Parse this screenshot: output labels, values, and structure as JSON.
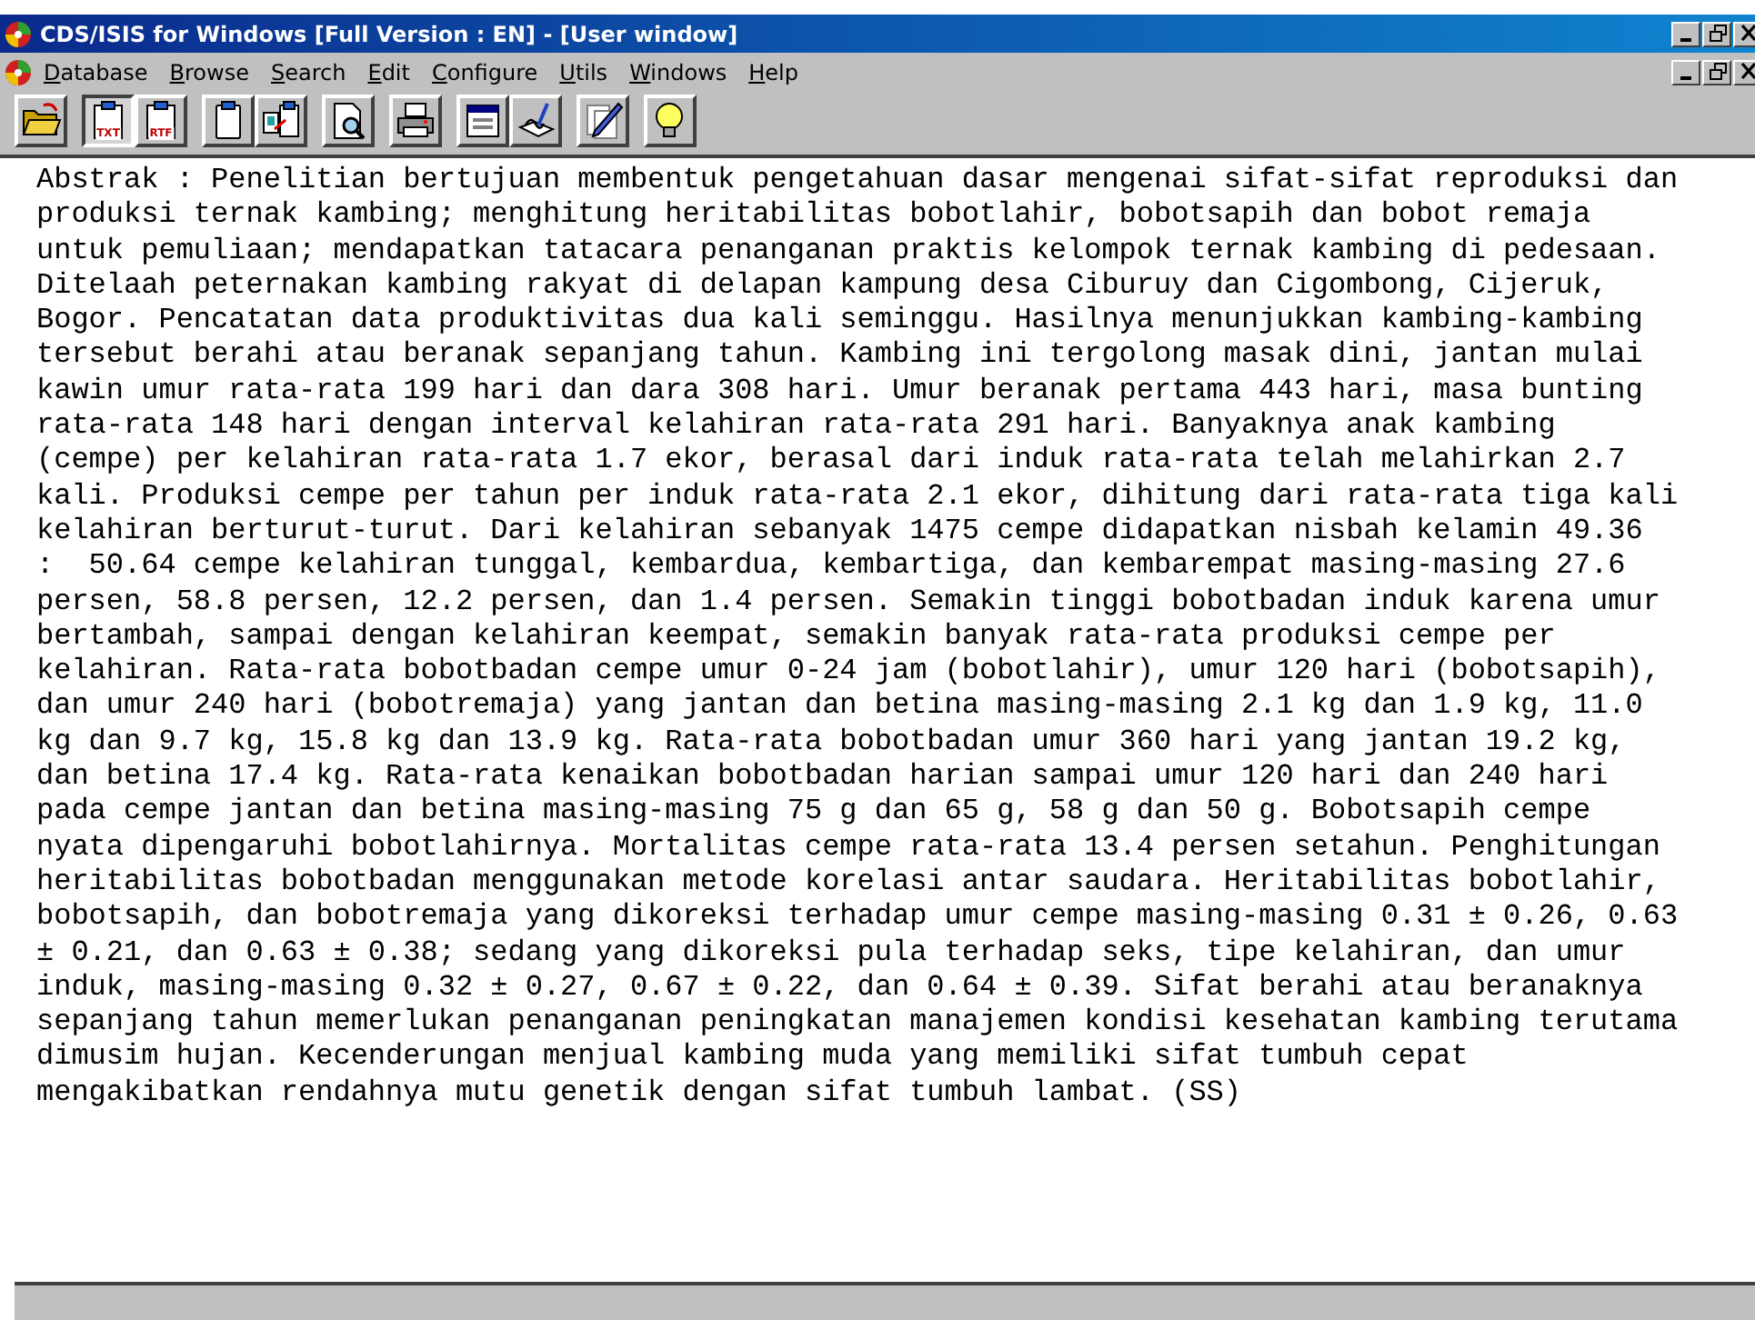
{
  "window": {
    "title": "CDS/ISIS for Windows [Full Version : EN] - [User window]"
  },
  "menu": [
    {
      "label": "Database"
    },
    {
      "label": "Browse"
    },
    {
      "label": "Search"
    },
    {
      "label": "Edit"
    },
    {
      "label": "Configure"
    },
    {
      "label": "Utils"
    },
    {
      "label": "Windows"
    },
    {
      "label": "Help"
    }
  ],
  "toolbar": [
    {
      "buttons": [
        {
          "kind": "folder",
          "selected": false
        }
      ]
    },
    {
      "buttons": [
        {
          "kind": "doc",
          "label": "TXT",
          "selected": true
        },
        {
          "kind": "doc",
          "label": "RTF",
          "selected": false
        }
      ]
    },
    {
      "buttons": [
        {
          "kind": "clipboard",
          "selected": false
        },
        {
          "kind": "clipcopy",
          "selected": false
        }
      ]
    },
    {
      "buttons": [
        {
          "kind": "preview",
          "selected": false
        }
      ]
    },
    {
      "buttons": [
        {
          "kind": "printer",
          "selected": false
        }
      ]
    },
    {
      "buttons": [
        {
          "kind": "form",
          "selected": false
        },
        {
          "kind": "sign",
          "selected": false
        }
      ]
    },
    {
      "buttons": [
        {
          "kind": "pencil",
          "selected": false
        }
      ]
    },
    {
      "buttons": [
        {
          "kind": "bulb",
          "selected": false
        }
      ]
    }
  ],
  "abstract": "Abstrak : Penelitian bertujuan membentuk pengetahuan dasar mengenai sifat-sifat reproduksi dan\nproduksi ternak kambing; menghitung heritabilitas bobotlahir, bobotsapih dan bobot remaja\nuntuk pemuliaan; mendapatkan tatacara penanganan praktis kelompok ternak kambing di pedesaan.\nDitelaah peternakan kambing rakyat di delapan kampung desa Ciburuy dan Cigombong, Cijeruk,\nBogor. Pencatatan data produktivitas dua kali seminggu. Hasilnya menunjukkan kambing-kambing\ntersebut berahi atau beranak sepanjang tahun. Kambing ini tergolong masak dini, jantan mulai\nkawin umur rata-rata 199 hari dan dara 308 hari. Umur beranak pertama 443 hari, masa bunting\nrata-rata 148 hari dengan interval kelahiran rata-rata 291 hari. Banyaknya anak kambing\n(cempe) per kelahiran rata-rata 1.7 ekor, berasal dari induk rata-rata telah melahirkan 2.7\nkali. Produksi cempe per tahun per induk rata-rata 2.1 ekor, dihitung dari rata-rata tiga kali\nkelahiran berturut-turut. Dari kelahiran sebanyak 1475 cempe didapatkan nisbah kelamin 49.36\n:  50.64 cempe kelahiran tunggal, kembardua, kembartiga, dan kembarempat masing-masing 27.6\npersen, 58.8 persen, 12.2 persen, dan 1.4 persen. Semakin tinggi bobotbadan induk karena umur\nbertambah, sampai dengan kelahiran keempat, semakin banyak rata-rata produksi cempe per\nkelahiran. Rata-rata bobotbadan cempe umur 0-24 jam (bobotlahir), umur 120 hari (bobotsapih),\ndan umur 240 hari (bobotremaja) yang jantan dan betina masing-masing 2.1 kg dan 1.9 kg, 11.0\nkg dan 9.7 kg, 15.8 kg dan 13.9 kg. Rata-rata bobotbadan umur 360 hari yang jantan 19.2 kg,\ndan betina 17.4 kg. Rata-rata kenaikan bobotbadan harian sampai umur 120 hari dan 240 hari\npada cempe jantan dan betina masing-masing 75 g dan 65 g, 58 g dan 50 g. Bobotsapih cempe\nnyata dipengaruhi bobotlahirnya. Mortalitas cempe rata-rata 13.4 persen setahun. Penghitungan\nheritabilitas bobotbadan menggunakan metode korelasi antar saudara. Heritabilitas bobotlahir,\nbobotsapih, dan bobotremaja yang dikoreksi terhadap umur cempe masing-masing 0.31 ± 0.26, 0.63\n± 0.21, dan 0.63 ± 0.38; sedang yang dikoreksi pula terhadap seks, tipe kelahiran, dan umur\ninduk, masing-masing 0.32 ± 0.27, 0.67 ± 0.22, dan 0.64 ± 0.39. Sifat berahi atau beranaknya\nsepanjang tahun memerlukan penanganan peningkatan manajemen kondisi kesehatan kambing terutama\ndimusim hujan. Kecenderungan menjual kambing muda yang memiliki sifat tumbuh cepat\nmengakibatkan rendahnya mutu genetik dengan sifat tumbuh lambat. (SS)"
}
